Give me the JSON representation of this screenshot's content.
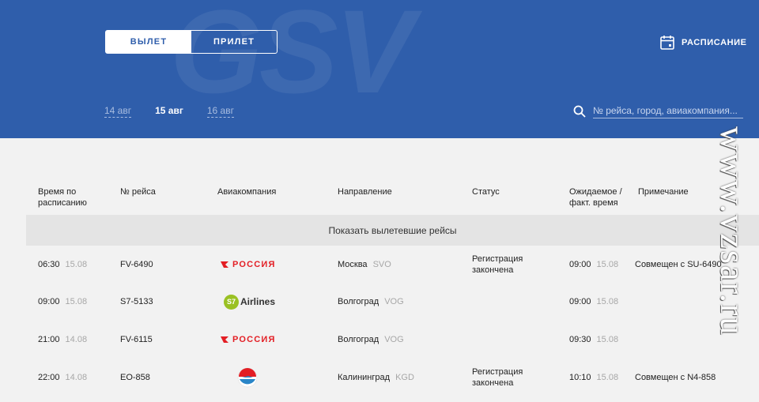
{
  "header": {
    "brand": "GSV",
    "tabs": [
      {
        "label": "ВЫЛЕТ",
        "active": true
      },
      {
        "label": "ПРИЛЕТ",
        "active": false
      }
    ],
    "schedule_label": "РАСПИСАНИЕ",
    "dates": [
      {
        "label": "14 авг",
        "active": false
      },
      {
        "label": "15 авг",
        "active": true
      },
      {
        "label": "16 авг",
        "active": false
      }
    ],
    "search_placeholder": "№ рейса, город, авиакомпания..."
  },
  "columns": {
    "sched_time": "Время по расписанию",
    "flight_no": "№ рейса",
    "airline": "Авиакомпания",
    "direction": "Направление",
    "status": "Статус",
    "expected": "Ожидаемое / факт. время",
    "note": "Примечание"
  },
  "show_departed_label": "Показать вылетевшие рейсы",
  "flights": [
    {
      "time": "06:30",
      "date": "15.08",
      "flight": "FV-6490",
      "airline": "РОССИЯ",
      "airline_logo": "rossiya-logo",
      "city": "Москва",
      "code": "SVO",
      "status_line1": "Регистрация",
      "status_line2": "закончена",
      "exp_time": "09:00",
      "exp_date": "15.08",
      "note": "Совмещен с SU-6490"
    },
    {
      "time": "09:00",
      "date": "15.08",
      "flight": "S7-5133",
      "airline": "Airlines",
      "airline_logo": "s7-logo",
      "city": "Волгоград",
      "code": "VOG",
      "status_line1": "",
      "status_line2": "",
      "exp_time": "09:00",
      "exp_date": "15.08",
      "note": ""
    },
    {
      "time": "21:00",
      "date": "14.08",
      "flight": "FV-6115",
      "airline": "РОССИЯ",
      "airline_logo": "rossiya-logo",
      "city": "Волгоград",
      "code": "VOG",
      "status_line1": "",
      "status_line2": "",
      "exp_time": "09:30",
      "exp_date": "15.08",
      "note": ""
    },
    {
      "time": "22:00",
      "date": "14.08",
      "flight": "EO-858",
      "airline": "",
      "airline_logo": "ikar-logo",
      "city": "Калининград",
      "code": "KGD",
      "status_line1": "Регистрация",
      "status_line2": "закончена",
      "exp_time": "10:10",
      "exp_date": "15.08",
      "note": "Совмещен с N4-858"
    }
  ],
  "overlay_watermark": "www.vzsar.ru",
  "colors": {
    "header_bg": "#2f5eab",
    "status_green": "#3d9a3d",
    "rossiya_red": "#e31e24",
    "s7_green": "#9ac123"
  }
}
